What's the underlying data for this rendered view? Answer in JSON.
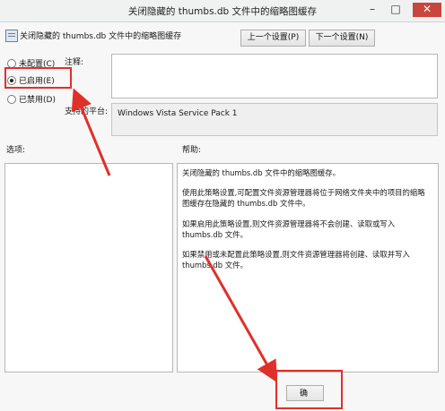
{
  "window": {
    "title": "关闭隐藏的 thumbs.db 文件中的缩略图缓存",
    "minimize": "–",
    "maximize": "□",
    "close": "✕"
  },
  "header": {
    "policy_name": "关闭隐藏的 thumbs.db 文件中的缩略图缓存"
  },
  "nav": {
    "prev_label": "上一个设置(P)",
    "next_label": "下一个设置(N)"
  },
  "options": {
    "not_configured": "未配置(C)",
    "enabled": "已启用(E)",
    "disabled": "已禁用(D)",
    "selected": "enabled"
  },
  "labels": {
    "comment": "注释:",
    "supported_on": "支持的平台:",
    "options_header": "选项:",
    "help_header": "帮助:"
  },
  "supported_on": {
    "value": "Windows Vista Service Pack 1"
  },
  "help": {
    "paragraphs": [
      "关闭隐藏的 thumbs.db 文件中的缩略图缓存。",
      "使用此策略设置,可配置文件资源管理器将位于网络文件夹中的项目的缩略图缓存在隐藏的 thumbs.db 文件中。",
      "如果启用此策略设置,则文件资源管理器将不会创建、读取或写入 thumbs.db 文件。",
      "如果禁用或未配置此策略设置,则文件资源管理器将创建、读取并写入 thumbs.db 文件。"
    ]
  },
  "footer": {
    "ok_label": "确"
  },
  "annotation": {
    "color": "#e0302a"
  }
}
